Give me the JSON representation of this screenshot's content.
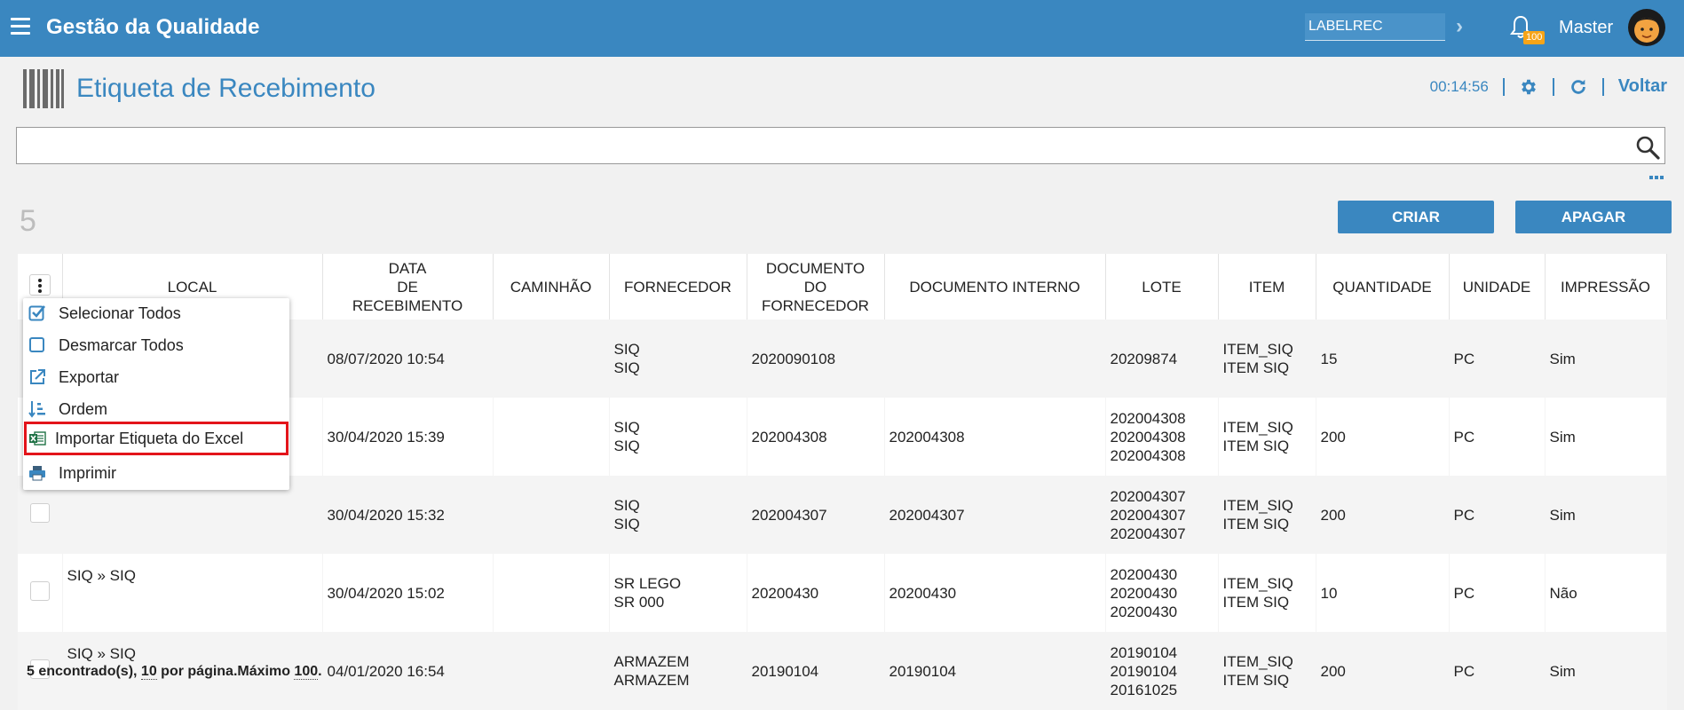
{
  "app": {
    "title": "Gestão da Qualidade"
  },
  "topbar": {
    "label_input_value": "LABELREC",
    "notification_count": "100",
    "username": "Master"
  },
  "page": {
    "title": "Etiqueta de Recebimento",
    "timer": "00:14:56",
    "back_label": "Voltar"
  },
  "search": {
    "value": "",
    "placeholder": ""
  },
  "result_count": "5",
  "actions": {
    "create_label": "CRIAR",
    "delete_label": "APAGAR"
  },
  "table": {
    "headers": {
      "local": "LOCAL",
      "data_line1": "DATA",
      "data_line2": "DE",
      "data_line3": "RECEBIMENTO",
      "caminhao": "CAMINHÃO",
      "fornecedor": "FORNECEDOR",
      "docforn_line1": "DOCUMENTO",
      "docforn_line2": "DO",
      "docforn_line3": "FORNECEDOR",
      "docinterno": "DOCUMENTO INTERNO",
      "lote": "LOTE",
      "item": "ITEM",
      "quantidade": "QUANTIDADE",
      "unidade": "UNIDADE",
      "impressao": "IMPRESSÃO"
    },
    "rows": [
      {
        "local": "",
        "data": "08/07/2020 10:54",
        "caminhao": "",
        "fornecedor1": "SIQ",
        "fornecedor2": "SIQ",
        "doc_fornecedor": "2020090108",
        "doc_interno": "",
        "lote1": "20209874",
        "lote2": "",
        "lote3": "",
        "item1": "ITEM_SIQ",
        "item2": "ITEM SIQ",
        "quantidade": "15",
        "unidade": "PC",
        "impressao": "Sim"
      },
      {
        "local": "",
        "data": "30/04/2020 15:39",
        "caminhao": "",
        "fornecedor1": "SIQ",
        "fornecedor2": "SIQ",
        "doc_fornecedor": "202004308",
        "doc_interno": "202004308",
        "lote1": "202004308",
        "lote2": "202004308",
        "lote3": "202004308",
        "item1": "ITEM_SIQ",
        "item2": "ITEM SIQ",
        "quantidade": "200",
        "unidade": "PC",
        "impressao": "Sim"
      },
      {
        "local": "",
        "data": "30/04/2020 15:32",
        "caminhao": "",
        "fornecedor1": "SIQ",
        "fornecedor2": "SIQ",
        "doc_fornecedor": "202004307",
        "doc_interno": "202004307",
        "lote1": "202004307",
        "lote2": "202004307",
        "lote3": "202004307",
        "item1": "ITEM_SIQ",
        "item2": "ITEM SIQ",
        "quantidade": "200",
        "unidade": "PC",
        "impressao": "Sim"
      },
      {
        "local": "SIQ » SIQ",
        "data": "30/04/2020 15:02",
        "caminhao": "",
        "fornecedor1": "SR LEGO",
        "fornecedor2": "SR 000",
        "doc_fornecedor": "20200430",
        "doc_interno": "20200430",
        "lote1": "20200430",
        "lote2": "20200430",
        "lote3": "20200430",
        "item1": "ITEM_SIQ",
        "item2": "ITEM SIQ",
        "quantidade": "10",
        "unidade": "PC",
        "impressao": "Não"
      },
      {
        "local": "SIQ » SIQ",
        "data": "04/01/2020 16:54",
        "caminhao": "",
        "fornecedor1": "ARMAZEM",
        "fornecedor2": "ARMAZEM",
        "doc_fornecedor": "20190104",
        "doc_interno": "20190104",
        "lote1": "20190104",
        "lote2": "20190104",
        "lote3": "20161025",
        "item1": "ITEM_SIQ",
        "item2": "ITEM SIQ",
        "quantidade": "200",
        "unidade": "PC",
        "impressao": "Sim"
      }
    ]
  },
  "pagination": {
    "found_text": "5 encontrado(s),",
    "page_size": "10",
    "per_page_text": "por página.Máximo",
    "max": "100",
    "end": "."
  },
  "menu": {
    "select_all": "Selecionar Todos",
    "deselect_all": "Desmarcar Todos",
    "export": "Exportar",
    "order": "Ordem",
    "import_excel": "Importar Etiqueta do Excel",
    "print": "Imprimir"
  },
  "colors": {
    "primary": "#3a87c0",
    "badge": "#f7a417",
    "highlight": "#e3141b",
    "excel": "#1e7145"
  },
  "icons": [
    "hamburger-icon",
    "chevron-right-icon",
    "bell-icon",
    "avatar",
    "barcode-icon",
    "gear-icon",
    "refresh-icon",
    "search-icon",
    "more-dots-icon",
    "kebab-icon",
    "checkbox-checked-icon",
    "checkbox-empty-icon",
    "export-icon",
    "sort-icon",
    "excel-icon",
    "printer-icon"
  ]
}
